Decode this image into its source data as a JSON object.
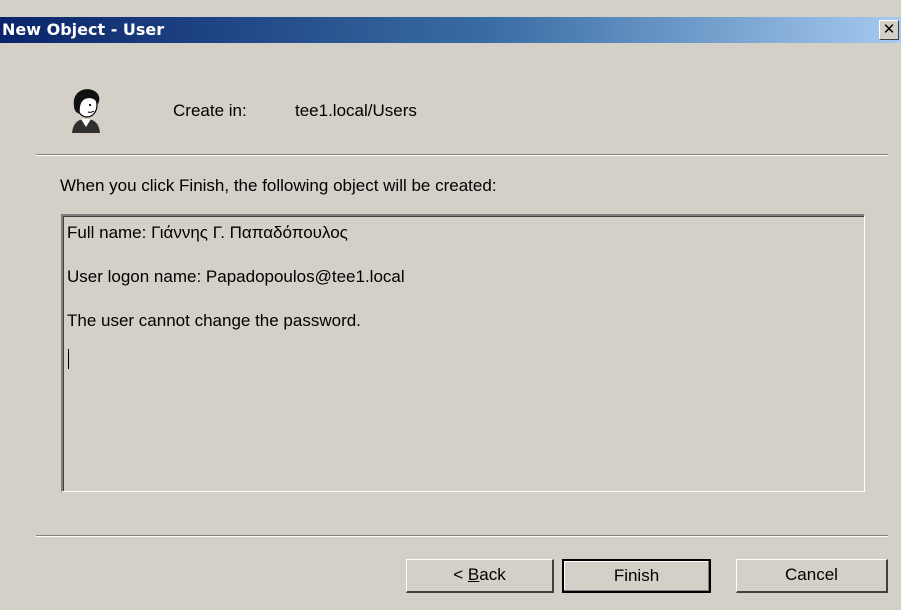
{
  "window": {
    "title": "New Object - User",
    "close_label": "✕"
  },
  "header": {
    "create_in_label": "Create in:",
    "create_in_path": "tee1.local/Users",
    "icon": "user-icon"
  },
  "intro_text": "When you click Finish, the following object will be created:",
  "summary": {
    "lines": [
      "Full name: Γιάννης Γ. Παπαδόπουλος",
      "User logon name: Papadopoulos@tee1.local",
      "The user cannot change the password."
    ]
  },
  "buttons": {
    "back": {
      "prefix": "< ",
      "mnemonic": "B",
      "rest": "ack"
    },
    "finish": "Finish",
    "cancel": "Cancel"
  },
  "colors": {
    "dialog_bg": "#d4d0c8",
    "title_start": "#0a246a",
    "title_end": "#a6caf0"
  }
}
